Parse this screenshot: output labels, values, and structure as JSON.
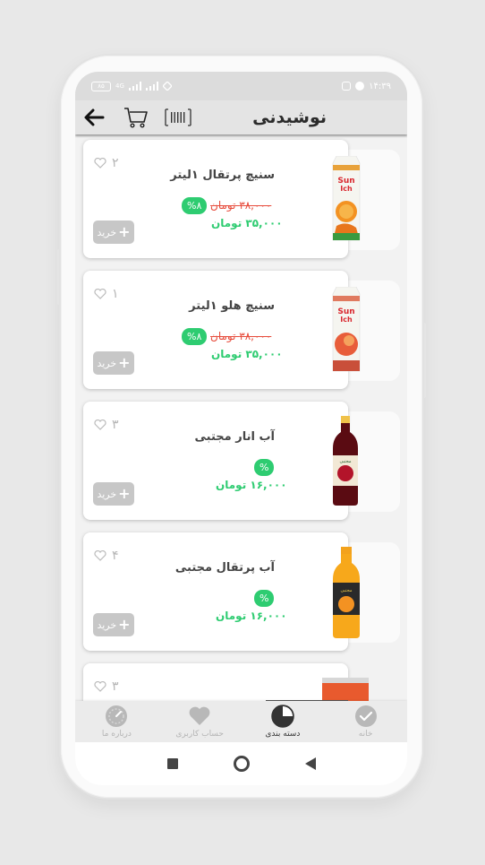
{
  "status_bar": {
    "battery": "۸۵",
    "network_label": "4G",
    "time": "۱۴:۳۹"
  },
  "app_bar": {
    "title": "نوشیدنی",
    "back_icon": "arrow-left-icon",
    "cart_icon": "cart-icon",
    "barcode_icon": "barcode-icon"
  },
  "products": [
    {
      "name": "سنیچ پرتقال ۱لیتر",
      "likes": "۲",
      "discount_badge": "%۸",
      "old_price": "۳۸,۰۰۰ تومان",
      "price": "۳۵,۰۰۰ تومان",
      "buy_label": "خرید",
      "image": "sunich-orange-carton"
    },
    {
      "name": "سنیچ هلو ۱لیتر",
      "likes": "۱",
      "discount_badge": "%۸",
      "old_price": "۳۸,۰۰۰ تومان",
      "price": "۳۵,۰۰۰ تومان",
      "buy_label": "خرید",
      "image": "sunich-peach-carton"
    },
    {
      "name": "آب انار مجتبی",
      "likes": "۳",
      "discount_badge": "%",
      "old_price": "",
      "price": "۱۶,۰۰۰ تومان",
      "buy_label": "خرید",
      "image": "pomegranate-bottle"
    },
    {
      "name": "آب پرتقال مجتبی",
      "likes": "۴",
      "discount_badge": "%",
      "old_price": "",
      "price": "۱۶,۰۰۰ تومان",
      "buy_label": "خرید",
      "image": "orange-bottle"
    },
    {
      "name": "",
      "likes": "۳",
      "discount_badge": "",
      "old_price": "",
      "price": "",
      "buy_label": "",
      "image": "can"
    }
  ],
  "bottom_nav": [
    {
      "label": "درباره ما",
      "icon": "speedometer-icon",
      "active": false
    },
    {
      "label": "حساب کاربری",
      "icon": "heart-icon",
      "active": false
    },
    {
      "label": "دسته بندی",
      "icon": "pie-chart-icon",
      "active": true
    },
    {
      "label": "خانه",
      "icon": "check-circle-icon",
      "active": false
    }
  ],
  "colors": {
    "discount_green": "#2ecc71",
    "old_price_red": "#e74c3c",
    "buy_button_gray": "#c7c7c7",
    "appbar_gray": "#e4e4e4"
  }
}
